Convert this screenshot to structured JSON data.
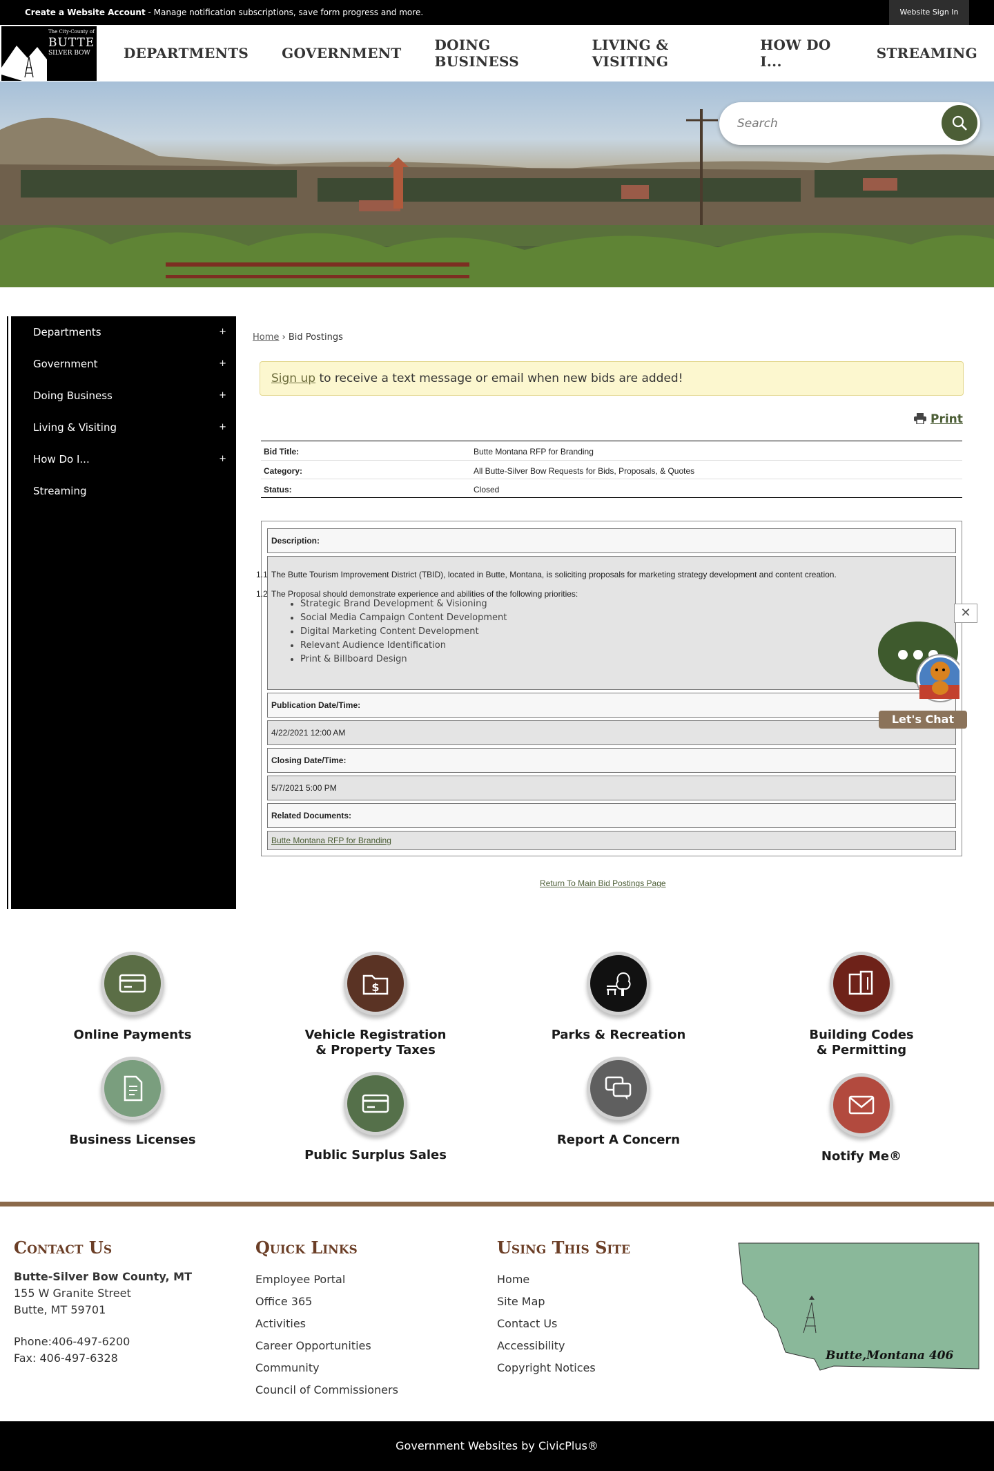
{
  "topbar": {
    "account_link": "Create a Website Account",
    "account_desc": " - Manage notification subscriptions, save form progress and more.",
    "signin": "Website Sign In"
  },
  "logo": {
    "line1": "The City-County of",
    "line2": "BUTTE",
    "line3": "SILVER BOW"
  },
  "nav": [
    "DEPARTMENTS",
    "GOVERNMENT",
    "DOING BUSINESS",
    "LIVING & VISITING",
    "HOW DO I...",
    "STREAMING"
  ],
  "search": {
    "placeholder": "Search"
  },
  "sidebar": {
    "items": [
      {
        "label": "Departments",
        "plus": "+"
      },
      {
        "label": "Government",
        "plus": "+"
      },
      {
        "label": "Doing Business",
        "plus": "+"
      },
      {
        "label": "Living & Visiting",
        "plus": "+"
      },
      {
        "label": "How Do I...",
        "plus": "+"
      },
      {
        "label": "Streaming",
        "plus": ""
      }
    ]
  },
  "breadcrumb": {
    "home": "Home",
    "sep": " › ",
    "current": "Bid Postings"
  },
  "notice": {
    "link": "Sign up",
    "text": " to receive a text message or email when new bids are added!"
  },
  "print_label": "Print",
  "bid": {
    "rows": [
      {
        "key": "Bid Title:",
        "value": "Butte Montana RFP for Branding"
      },
      {
        "key": "Category:",
        "value": "All Butte-Silver Bow Requests for Bids, Proposals, & Quotes"
      },
      {
        "key": "Status:",
        "value": "Closed"
      }
    ]
  },
  "detail": {
    "description_label": "Description:",
    "p1_num": "1.1",
    "p1": "The Butte Tourism Improvement District (TBID), located in Butte, Montana, is soliciting proposals for marketing strategy development and content creation.",
    "p2_num": "1.2",
    "p2": "The Proposal should demonstrate experience and abilities of the following priorities:",
    "priorities": [
      "Strategic Brand Development & Visioning",
      "Social Media Campaign Content Development",
      "Digital Marketing Content Development",
      "Relevant Audience Identification",
      "Print & Billboard Design"
    ],
    "pub_label": "Publication Date/Time:",
    "pub_value": "4/22/2021 12:00 AM",
    "close_label": "Closing Date/Time:",
    "close_value": "5/7/2021 5:00 PM",
    "related_label": "Related Documents:",
    "related_link": "Butte Montana RFP for Branding"
  },
  "return_link": "Return To Main Bid Postings Page",
  "chat": {
    "close": "✕",
    "label": "Let's Chat"
  },
  "tiles": [
    {
      "label": "Online Payments",
      "color": "#5b6e46",
      "icon": "credit-card-icon"
    },
    {
      "label": "Vehicle Registration & Property Taxes",
      "color": "#5a3324",
      "icon": "folder-dollar-icon"
    },
    {
      "label": "Parks & Recreation",
      "color": "#111111",
      "icon": "tree-bench-icon"
    },
    {
      "label": "Building Codes & Permitting",
      "color": "#6e2219",
      "icon": "blueprint-icon"
    },
    {
      "label": "Business Licenses",
      "color": "#7a9e7e",
      "icon": "document-icon"
    },
    {
      "label": "Public Surplus Sales",
      "color": "#55704a",
      "icon": "credit-card-icon"
    },
    {
      "label": "Report A Concern",
      "color": "#5f5f5f",
      "icon": "chat-bubbles-icon"
    },
    {
      "label": "Notify Me®",
      "color": "#b24a3e",
      "icon": "envelope-icon"
    }
  ],
  "footer": {
    "contact": {
      "title": "Contact Us",
      "name": "Butte-Silver Bow County, MT",
      "street": "155 W Granite Street",
      "city": "Butte, MT 59701",
      "phone": "Phone:406-497-6200",
      "fax": "Fax: 406-497-6328"
    },
    "quick_links": {
      "title": "Quick Links",
      "items": [
        "Employee Portal",
        "Office 365",
        "Activities",
        "Career Opportunities",
        "Community",
        "Council of Commissioners"
      ]
    },
    "using_site": {
      "title": "Using This Site",
      "items": [
        "Home",
        "Site Map",
        "Contact Us",
        "Accessibility",
        "Copyright Notices"
      ]
    },
    "map_caption": "Butte,Montana 406",
    "credit": "Government Websites by CivicPlus®"
  },
  "colors": {
    "accent": "#4c5e36",
    "brown": "#6b3e26",
    "footer_line": "#8b6a4a"
  }
}
